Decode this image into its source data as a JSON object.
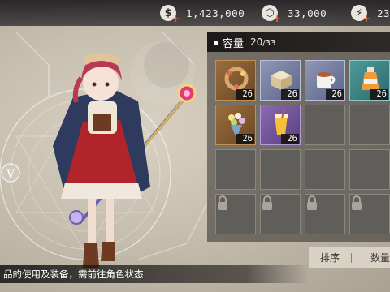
{
  "currencies": [
    {
      "icon": "coin-icon",
      "glyph": "$",
      "value": "1,423,000"
    },
    {
      "icon": "gem-icon",
      "glyph": "⬡",
      "value": "33,000"
    },
    {
      "icon": "lightning-icon",
      "glyph": "⚡",
      "value": "23"
    }
  ],
  "inventory": {
    "title": "容量",
    "count": "20",
    "capacity": "/33",
    "items": [
      {
        "name": "wreath-item-icon",
        "qty": "26",
        "rarity": "brown"
      },
      {
        "name": "wooden-box-item-icon",
        "qty": "26",
        "rarity": "blue"
      },
      {
        "name": "tea-cup-item-icon",
        "qty": "26",
        "rarity": "blue"
      },
      {
        "name": "potion-bottle-item-icon",
        "qty": "26",
        "rarity": "teal"
      },
      {
        "name": "flower-bouquet-item-icon",
        "qty": "26",
        "rarity": "brown"
      },
      {
        "name": "drink-glass-item-icon",
        "qty": "26",
        "rarity": "purple"
      }
    ]
  },
  "hint": "品的使用及装备，需前往角色状态",
  "sort": {
    "sort_label": "排序",
    "qty_label": "数量"
  }
}
